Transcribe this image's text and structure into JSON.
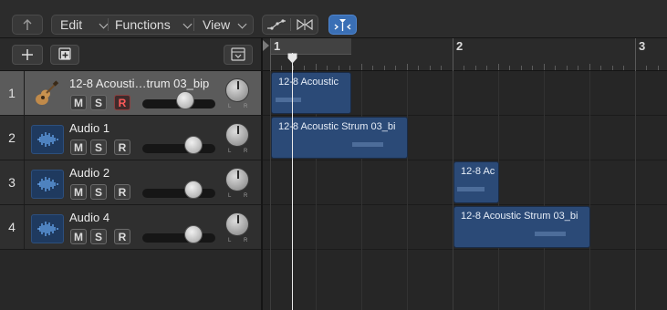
{
  "toolbar": {
    "menus": [
      "Edit",
      "Functions",
      "View"
    ]
  },
  "tracks": [
    {
      "number": "1",
      "name": "12-8 Acousti…trum 03_bip",
      "mute": "M",
      "solo": "S",
      "record": "R",
      "selected": true,
      "icon": "acoustic-guitar-icon"
    },
    {
      "number": "2",
      "name": "Audio 1",
      "mute": "M",
      "solo": "S",
      "record": "R",
      "selected": false,
      "icon": "audio-waveform-icon"
    },
    {
      "number": "3",
      "name": "Audio 2",
      "mute": "M",
      "solo": "S",
      "record": "R",
      "selected": false,
      "icon": "audio-waveform-icon"
    },
    {
      "number": "4",
      "name": "Audio 4",
      "mute": "M",
      "solo": "S",
      "record": "R",
      "selected": false,
      "icon": "audio-waveform-icon"
    }
  ],
  "pan": {
    "left": "L",
    "right": "R"
  },
  "ruler": {
    "bars": [
      "1",
      "2",
      "3"
    ]
  },
  "regions": [
    {
      "track": 1,
      "name": "12-8 Acoustic"
    },
    {
      "track": 2,
      "name": "12-8 Acoustic Strum 03_bi"
    },
    {
      "track": 3,
      "name": "12-8 Ac"
    },
    {
      "track": 4,
      "name": "12-8 Acoustic Strum 03_bi"
    }
  ],
  "colors": {
    "region": "#2b4a77",
    "selected_track": "#5b5b5b",
    "record_active": "#ff5a5a",
    "accent_button": "#3a6fb5"
  }
}
